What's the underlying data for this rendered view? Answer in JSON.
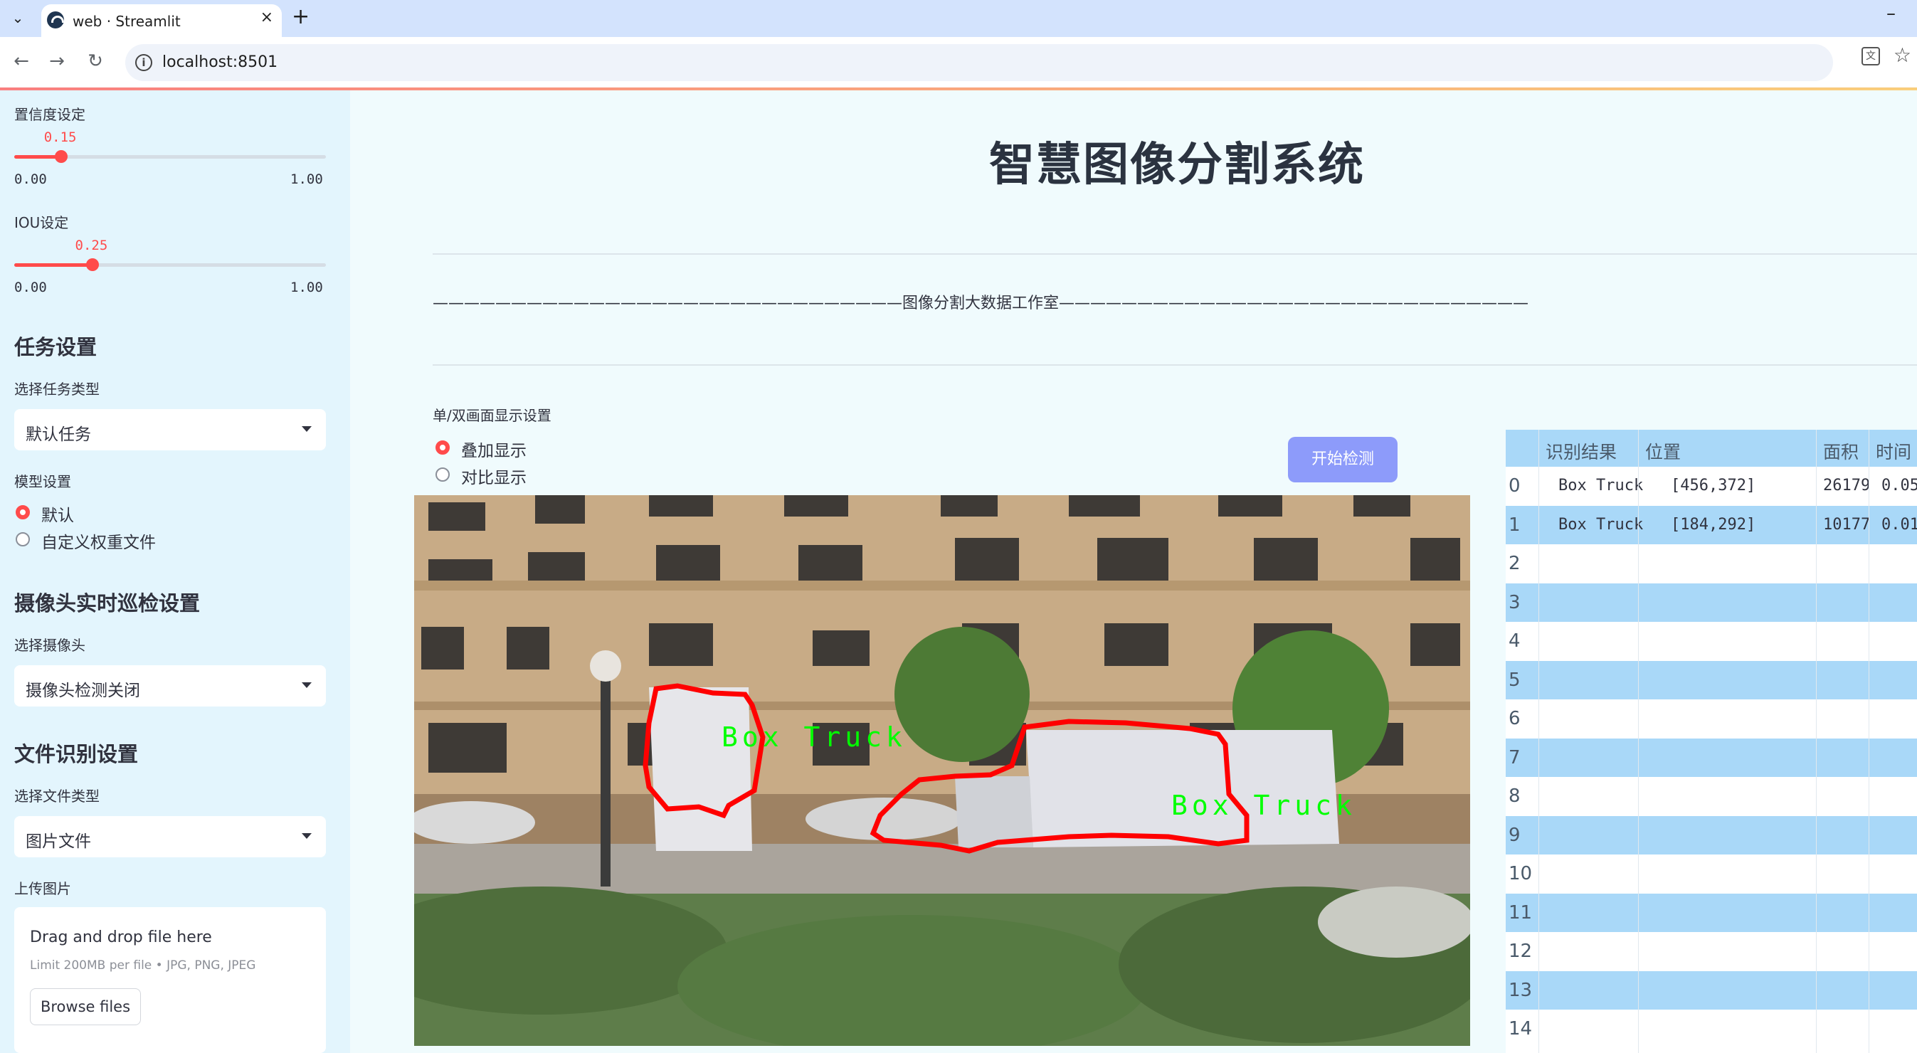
{
  "browser": {
    "tab_title": "web · Streamlit",
    "url": "localhost:8501"
  },
  "sidebar": {
    "conf": {
      "label": "置信度设定",
      "value": "0.15",
      "fraction": 0.15,
      "min": "0.00",
      "max": "1.00"
    },
    "iou": {
      "label": "IOU设定",
      "value": "0.25",
      "fraction": 0.25,
      "min": "0.00",
      "max": "1.00"
    },
    "task_header": "任务设置",
    "task_type_label": "选择任务类型",
    "task_type_value": "默认任务",
    "model_label": "模型设置",
    "model_options": [
      "默认",
      "自定义权重文件"
    ],
    "model_selected": 0,
    "camera_header": "摄像头实时巡检设置",
    "camera_label": "选择摄像头",
    "camera_value": "摄像头检测关闭",
    "file_header": "文件识别设置",
    "file_type_label": "选择文件类型",
    "file_type_value": "图片文件",
    "upload_label": "上传图片",
    "dropzone_title": "Drag and drop file here",
    "dropzone_limit": "Limit 200MB per file • JPG, PNG, JPEG",
    "browse_label": "Browse files"
  },
  "main": {
    "title": "智慧图像分割系统",
    "subtitle_line": "——————————————————————————————图像分割大数据工作室——————————————————————————————",
    "display_mode_label": "单/双画面显示设置",
    "display_options": [
      "叠加显示",
      "对比显示"
    ],
    "display_selected": 0,
    "start_button": "开始检测",
    "detections": [
      {
        "label": "Box Truck"
      },
      {
        "label": "Box Truck"
      }
    ]
  },
  "table": {
    "headers": [
      "识别结果",
      "位置",
      "面积",
      "时间"
    ],
    "rows": [
      {
        "idx": "0",
        "result": "Box Truck",
        "pos": "[456,372]",
        "area": "26179",
        "time": "0.05"
      },
      {
        "idx": "1",
        "result": "Box Truck",
        "pos": "[184,292]",
        "area": "10177",
        "time": "0.01"
      },
      {
        "idx": "2"
      },
      {
        "idx": "3"
      },
      {
        "idx": "4"
      },
      {
        "idx": "5"
      },
      {
        "idx": "6"
      },
      {
        "idx": "7"
      },
      {
        "idx": "8"
      },
      {
        "idx": "9"
      },
      {
        "idx": "10"
      },
      {
        "idx": "11"
      },
      {
        "idx": "12"
      },
      {
        "idx": "13"
      },
      {
        "idx": "14"
      }
    ]
  },
  "colors": {
    "accent": "#ff4b4b",
    "sidebar_bg": "#e3f5fd",
    "table_band": "#a9d8f8",
    "button": "#8d9bfa",
    "mask_outline": "#ff0000",
    "mask_label": "#00ff00"
  }
}
